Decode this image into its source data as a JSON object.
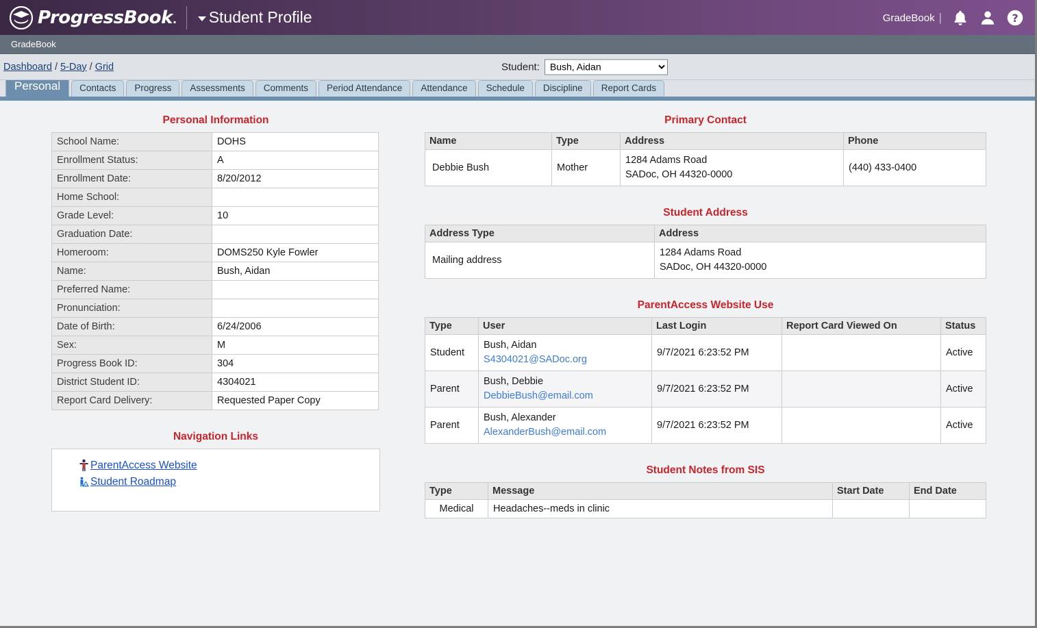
{
  "header": {
    "brand": "ProgressBook",
    "brand_suffix": ".",
    "title": "Student Profile",
    "user_label": "GradeBook",
    "pipe": "|",
    "icons": {
      "caret": "chevron-down-icon",
      "bell": "notification-bell-icon",
      "user": "user-account-icon",
      "help": "help-question-icon"
    }
  },
  "subbar": {
    "app": "GradeBook"
  },
  "breadcrumb": {
    "items": [
      "Dashboard",
      "5-Day",
      "Grid"
    ],
    "separator": "/"
  },
  "student_picker": {
    "label": "Student:",
    "value": "Bush, Aidan",
    "options": [
      "Bush, Aidan"
    ]
  },
  "tabs": [
    {
      "label": "Personal",
      "active": true
    },
    {
      "label": "Contacts",
      "active": false
    },
    {
      "label": "Progress",
      "active": false
    },
    {
      "label": "Assessments",
      "active": false
    },
    {
      "label": "Comments",
      "active": false
    },
    {
      "label": "Period Attendance",
      "active": false
    },
    {
      "label": "Attendance",
      "active": false
    },
    {
      "label": "Schedule",
      "active": false
    },
    {
      "label": "Discipline",
      "active": false
    },
    {
      "label": "Report Cards",
      "active": false
    }
  ],
  "personal_information": {
    "title": "Personal Information",
    "rows": [
      {
        "label": "School Name:",
        "value": "DOHS"
      },
      {
        "label": "Enrollment Status:",
        "value": "A"
      },
      {
        "label": "Enrollment Date:",
        "value": "8/20/2012"
      },
      {
        "label": "Home School:",
        "value": ""
      },
      {
        "label": "Grade Level:",
        "value": "10"
      },
      {
        "label": "Graduation Date:",
        "value": ""
      },
      {
        "label": "Homeroom:",
        "value": "DOMS250 Kyle Fowler"
      },
      {
        "label": "Name:",
        "value": "Bush, Aidan"
      },
      {
        "label": "Preferred Name:",
        "value": ""
      },
      {
        "label": "Pronunciation:",
        "value": ""
      },
      {
        "label": "Date of Birth:",
        "value": "6/24/2006"
      },
      {
        "label": "Sex:",
        "value": "M"
      },
      {
        "label": "Progress Book ID:",
        "value": "304"
      },
      {
        "label": "District Student ID:",
        "value": "4304021"
      },
      {
        "label": "Report Card Delivery:",
        "value": "Requested Paper Copy"
      }
    ]
  },
  "navigation_links": {
    "title": "Navigation Links",
    "links": [
      {
        "label": "ParentAccess Website",
        "icon": "person-icon"
      },
      {
        "label": "Student Roadmap",
        "icon": "person-roadmap-icon"
      }
    ]
  },
  "primary_contact": {
    "title": "Primary Contact",
    "columns": [
      "Name",
      "Type",
      "Address",
      "Phone"
    ],
    "rows": [
      {
        "name": "Debbie Bush",
        "type": "Mother",
        "address_line1": "1284 Adams Road",
        "address_line2": "SADoc, OH 44320-0000",
        "phone": "(440) 433-0400"
      }
    ]
  },
  "student_address": {
    "title": "Student Address",
    "columns": [
      "Address Type",
      "Address"
    ],
    "rows": [
      {
        "address_type": "Mailing address",
        "address_line1": "1284 Adams Road",
        "address_line2": "SADoc, OH 44320-0000"
      }
    ]
  },
  "parentaccess_website_use": {
    "title": "ParentAccess Website Use",
    "columns": [
      "Type",
      "User",
      "Last Login",
      "Report Card Viewed On",
      "Status"
    ],
    "rows": [
      {
        "type": "Student",
        "user_name": "Bush, Aidan",
        "user_email": "S4304021@SADoc.org",
        "last_login": "9/7/2021 6:23:52 PM",
        "report_card_viewed_on": "",
        "status": "Active"
      },
      {
        "type": "Parent",
        "user_name": "Bush, Debbie",
        "user_email": "DebbieBush@email.com",
        "last_login": "9/7/2021 6:23:52 PM",
        "report_card_viewed_on": "",
        "status": "Active"
      },
      {
        "type": "Parent",
        "user_name": "Bush, Alexander",
        "user_email": "AlexanderBush@email.com",
        "last_login": "9/7/2021 6:23:52 PM",
        "report_card_viewed_on": "",
        "status": "Active"
      }
    ]
  },
  "student_notes_from_sis": {
    "title": "Student Notes from SIS",
    "columns": [
      "Type",
      "Message",
      "Start Date",
      "End Date"
    ],
    "rows": [
      {
        "type": "Medical",
        "message": "Headaches--meds in clinic",
        "start_date": "",
        "end_date": ""
      }
    ]
  },
  "colors": {
    "brand_purple_dark": "#3a2845",
    "brand_purple_light": "#7d508c",
    "subbar_gray": "#646f7c",
    "tab_active": "#6d8fad",
    "tab_inactive": "#c9d8e5",
    "section_title_red": "#c7252b",
    "link_blue": "#1a4fd0"
  }
}
